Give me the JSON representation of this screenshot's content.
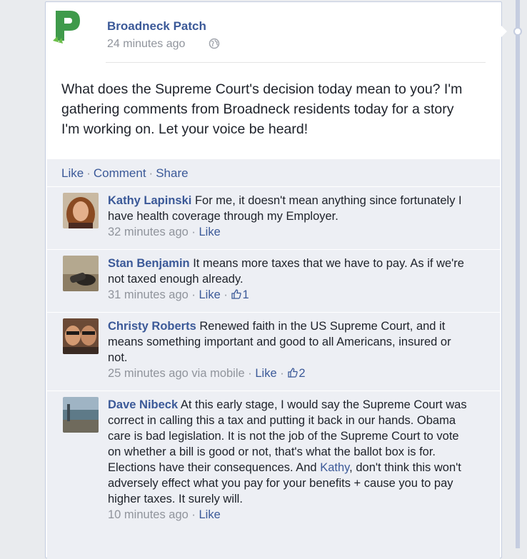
{
  "post": {
    "page_name": "Broadneck Patch",
    "timestamp": "24 minutes ago",
    "text": "What does the Supreme Court's decision today mean to you? I'm gathering comments from Broadneck residents today for a story I'm working on. Let your voice be heard!",
    "actions": {
      "like": "Like",
      "comment": "Comment",
      "share": "Share",
      "separator": "·"
    }
  },
  "comments": [
    {
      "author": "Kathy Lapinski",
      "text": "For me, it doesn't mean anything since fortunately I have health coverage through my Employer.",
      "time": "32 minutes ago",
      "like_label": "Like",
      "like_count": ""
    },
    {
      "author": "Stan Benjamin",
      "text": "It means more taxes that we have to pay. As if we're not taxed enough already.",
      "time": "31 minutes ago",
      "like_label": "Like",
      "like_count": "1"
    },
    {
      "author": "Christy Roberts",
      "text": "Renewed faith in the US Supreme Court, and it means something important and good to all Americans, insured or not.",
      "time": "25 minutes ago via mobile",
      "like_label": "Like",
      "like_count": "2"
    },
    {
      "author": "Dave Nibeck",
      "text_before_mention": "At this early stage, I would say the Supreme Court was correct in calling this a tax and putting it back in our hands. Obama care is bad legislation. It is not the job of the Supreme Court to vote on whether a bill is good or not, that's what the ballot box is for. Elections have their consequences. And",
      "mention": "Kathy",
      "text_after_mention": ", don't think this won't adversely effect what you pay for your benefits + cause you to pay higher taxes. It surely will.",
      "time": "10 minutes ago",
      "like_label": "Like",
      "like_count": ""
    }
  ],
  "colors": {
    "link": "#3b5998",
    "muted": "#90949c",
    "feedback_bg": "#edeff4",
    "logo_green": "#3f9a4b"
  },
  "icons": {
    "logo": "patch-p-logo-icon",
    "privacy": "globe-icon",
    "like": "thumbs-up-icon"
  }
}
